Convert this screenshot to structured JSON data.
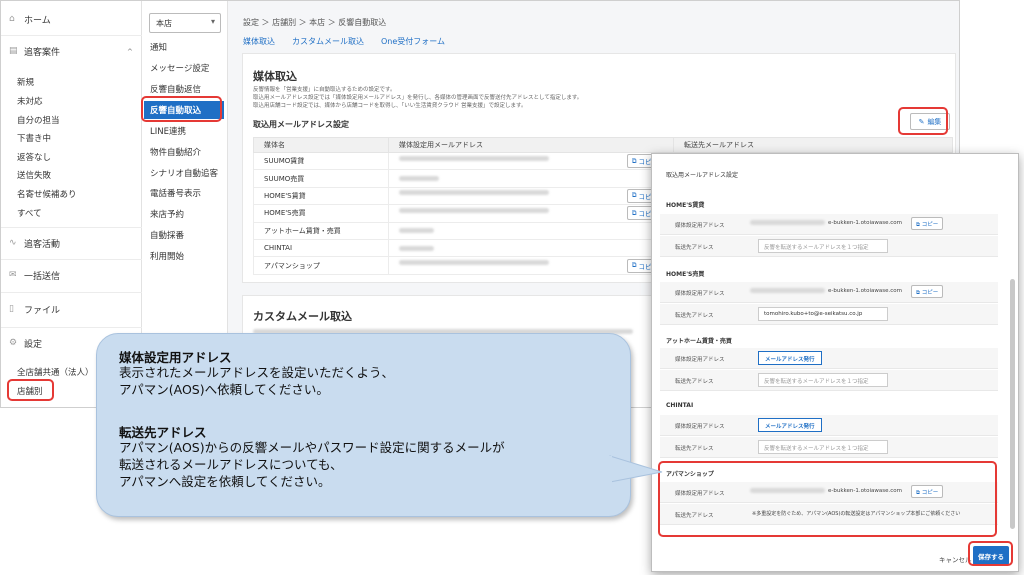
{
  "sidebar": {
    "home": "ホーム",
    "cases": "追客案件",
    "items": [
      "新規",
      "未対応",
      "自分の担当",
      "下書き中",
      "返答なし",
      "送信失敗",
      "名寄せ候補あり",
      "すべて"
    ],
    "activity": "追客活動",
    "bulk": "一括送信",
    "files": "ファイル",
    "settings": "設定",
    "sub": [
      "全店舗共通（法人）",
      "店舗別"
    ]
  },
  "submenu": {
    "shop": "本店",
    "items": [
      "通知",
      "メッセージ設定",
      "反響自動返信",
      "反響自動取込",
      "LINE連携",
      "物件自動紹介",
      "シナリオ自動追客",
      "電話番号表示",
      "来店予約",
      "自動採番",
      "利用開始"
    ]
  },
  "main": {
    "breadcrumb": "設定 ＞ 店舗別 ＞ 本店 ＞ 反響自動取込",
    "tabs": [
      "媒体取込",
      "カスタムメール取込",
      "One受付フォーム"
    ],
    "card1": {
      "title": "媒体取込",
      "desc": [
        "反響情報を「営業支援」に自動取込するための設定です。",
        "取込用メールアドレス設定では「媒体設定用メールアドレス」を発行し、各媒体の管理画面で反響送付先アドレスとして指定します。",
        "取込用店舗コード設定では、媒体から店舗コードを取得し、「いい生活賃貸クラウド 営業支援」で設定します。"
      ],
      "section": "取込用メールアドレス設定",
      "edit": "編集",
      "columns": [
        "媒体名",
        "媒体設定用メールアドレス",
        "転送先メールアドレス"
      ],
      "rows": [
        {
          "name": "SUUMO賃貸",
          "copy": "コピー"
        },
        {
          "name": "SUUMO売買",
          "copy": ""
        },
        {
          "name": "HOME'S賃貸",
          "copy": "コピー"
        },
        {
          "name": "HOME'S売買",
          "copy": "コピー"
        },
        {
          "name": "アットホーム賃貸・売買",
          "copy": ""
        },
        {
          "name": "CHINTAI",
          "copy": ""
        },
        {
          "name": "アパマンショップ",
          "copy": "コピー"
        }
      ]
    },
    "card2": {
      "title": "カスタムメール取込"
    }
  },
  "modal": {
    "top": "取込用メールアドレス設定",
    "label_media": "媒体設定用アドレス",
    "label_forward": "転送先アドレス",
    "copy": "コピー",
    "issue": "メールアドレス発行",
    "placeholder": "反響を転送するメールアドレスを１つ指定",
    "homes_chintai": {
      "title": "HOME'S賃貸",
      "domain": "e-bukken-1.otoiawase.com"
    },
    "homes_baibai": {
      "title": "HOME'S売買",
      "domain": "e-bukken-1.otoiawase.com",
      "forward": "tomohiro.kubo+to@e-seikatsu.co.jp"
    },
    "athome": {
      "title": "アットホーム賃貸・売買"
    },
    "chintai": {
      "title": "CHINTAI"
    },
    "apaman": {
      "title": "アパマンショップ",
      "domain": "e-bukken-1.otoiawase.com",
      "note": "※多重設定を防ぐため、アパマン(AOS)の転送設定はアパマンショップ本部にご依頼ください"
    },
    "cancel": "キャンセル",
    "save": "保存する"
  },
  "callout": {
    "h1": "媒体設定用アドレス",
    "t1": [
      "表示されたメールアドレスを設定いただくよう、",
      "アパマン(AOS)へ依頼してください。"
    ],
    "h2": "転送先アドレス",
    "t2": [
      "アパマン(AOS)からの反響メールやパスワード設定に関するメールが",
      "転送されるメールアドレスについても、",
      "アパマンへ設定を依頼してください。"
    ]
  },
  "colors": {
    "accent": "#1f6fc5",
    "highlight": "#e53935",
    "callout": "#c9dcef"
  }
}
